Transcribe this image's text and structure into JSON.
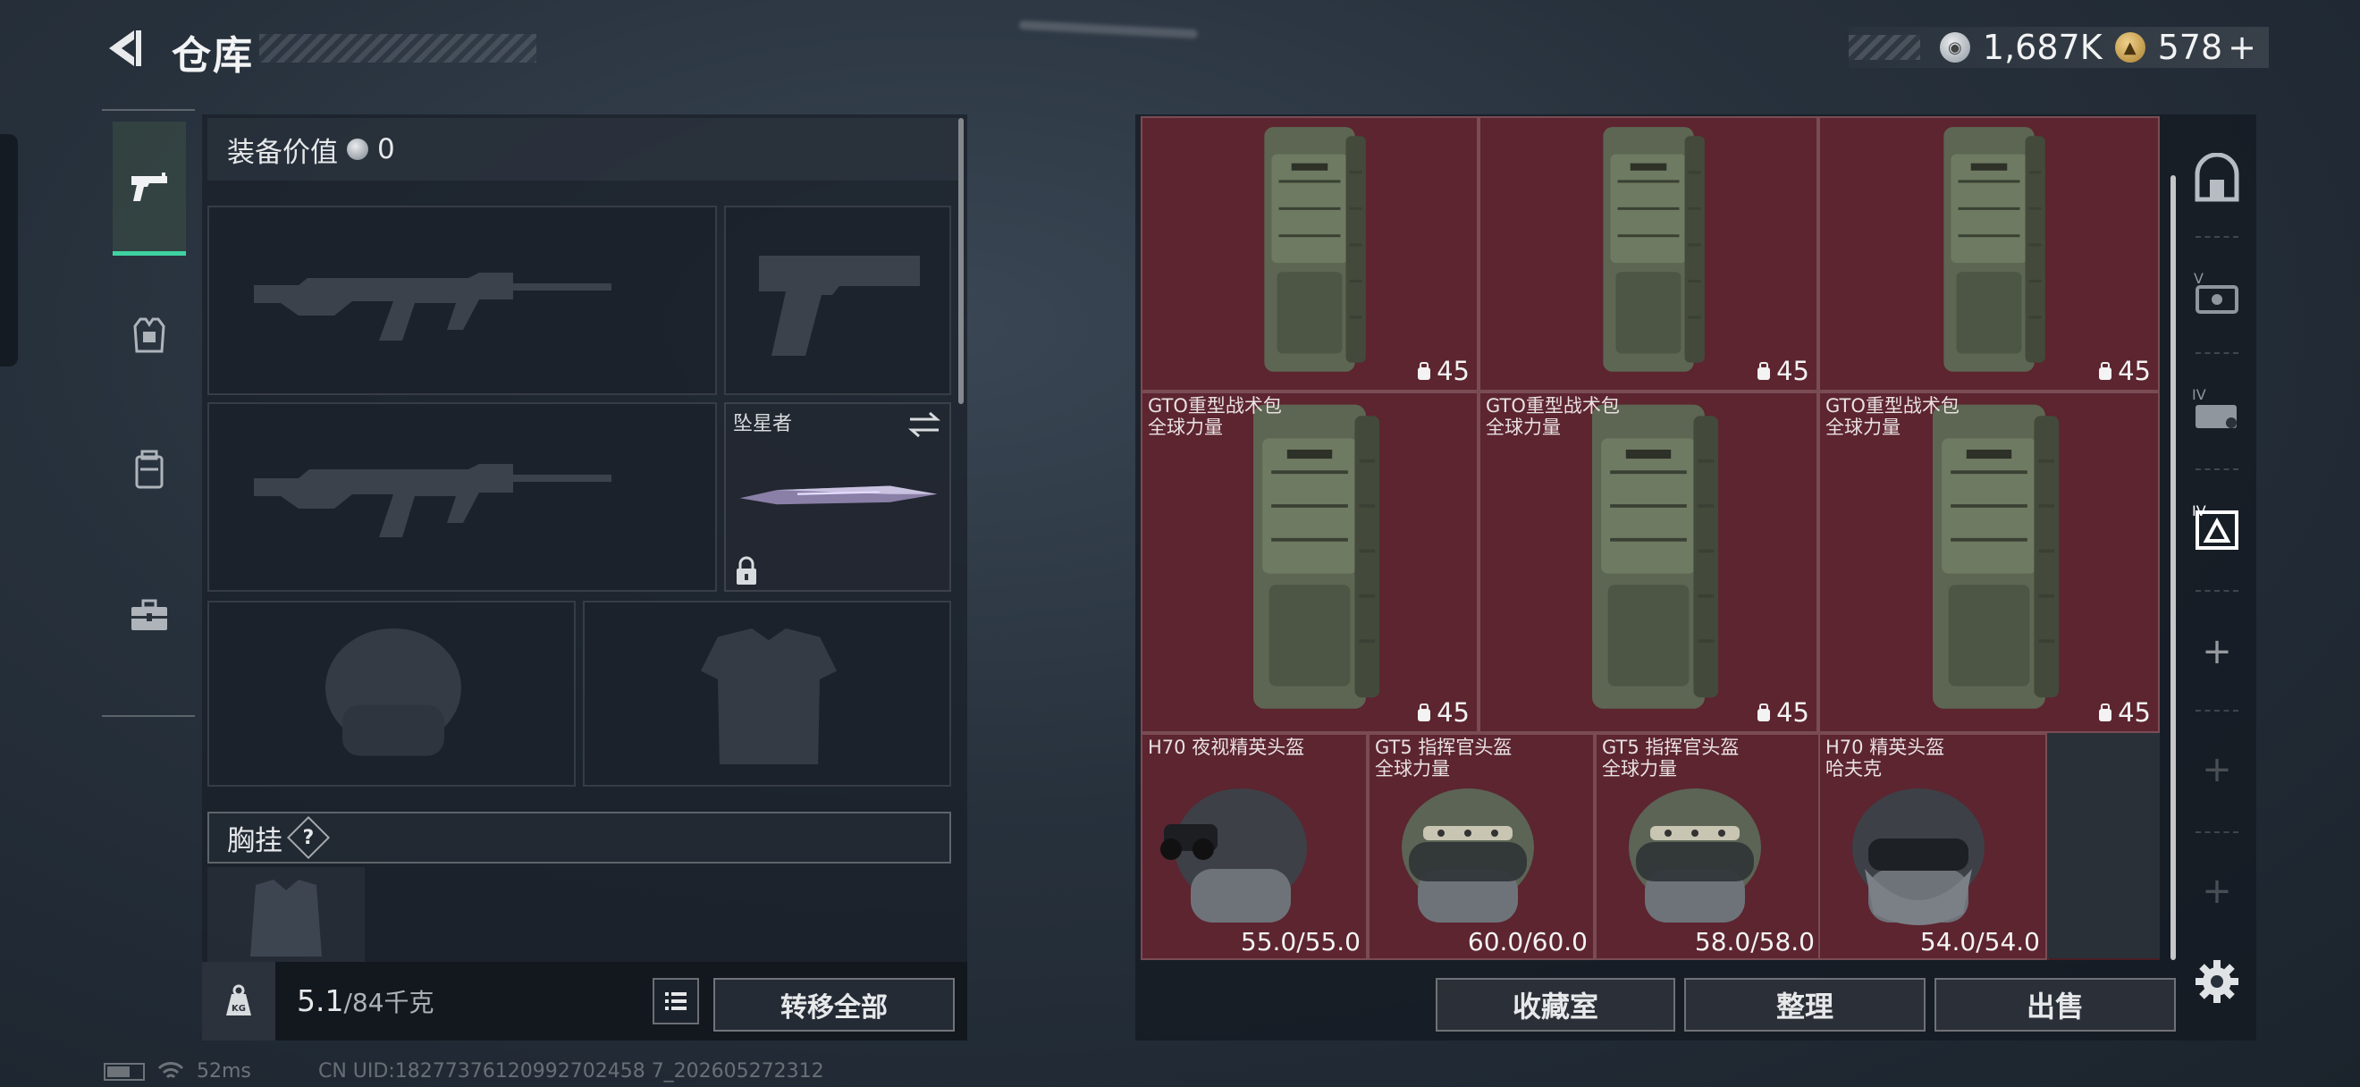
{
  "header": {
    "title": "仓库",
    "currency_silver": "1,687K",
    "currency_gold": "578",
    "add_symbol": "+"
  },
  "left_rail": {
    "items": [
      {
        "icon": "pistol-icon",
        "active": true
      },
      {
        "icon": "armor-vest-icon",
        "active": false
      },
      {
        "icon": "backpack-icon",
        "active": false
      },
      {
        "icon": "toolbox-icon",
        "active": false
      }
    ]
  },
  "loadout": {
    "value_label": "装备价值",
    "value_amount": "0",
    "melee_name": "坠星者",
    "chest_rig_label": "胸挂",
    "help_symbol": "?",
    "weight_current": "5.1",
    "weight_max": "/84千克",
    "weight_icon_text": "KG",
    "transfer_all_label": "转移全部"
  },
  "stash": {
    "items": [
      {
        "type": "backpack",
        "name1": "",
        "name2": "",
        "count": "45"
      },
      {
        "type": "backpack",
        "name1": "",
        "name2": "",
        "count": "45"
      },
      {
        "type": "backpack",
        "name1": "",
        "name2": "",
        "count": "45"
      },
      {
        "type": "backpack",
        "name1": "GTO重型战术包",
        "name2": "全球力量",
        "count": "45"
      },
      {
        "type": "backpack",
        "name1": "GTO重型战术包",
        "name2": "全球力量",
        "count": "45"
      },
      {
        "type": "backpack",
        "name1": "GTO重型战术包",
        "name2": "全球力量",
        "count": "45"
      },
      {
        "type": "helmet-nv",
        "name1": "H70 夜视精英头盔",
        "name2": "",
        "durability": "55.0/55.0"
      },
      {
        "type": "helmet-cmd",
        "name1": "GT5 指挥官头盔",
        "name2": "全球力量",
        "durability": "60.0/60.0"
      },
      {
        "type": "helmet-cmd",
        "name1": "GT5 指挥官头盔",
        "name2": "全球力量",
        "durability": "58.0/58.0"
      },
      {
        "type": "helmet-elite",
        "name1": "H70 精英头盔",
        "name2": "哈夫克",
        "durability": "54.0/54.0"
      }
    ],
    "buttons": {
      "collection": "收藏室",
      "sort": "整理",
      "sell": "出售"
    }
  },
  "right_rail": {
    "items": [
      "safe-box-icon",
      "case-v-icon",
      "case-iv-icon",
      "case-iv-active-icon"
    ],
    "plus": "+"
  },
  "status": {
    "ping": "52ms",
    "uid": "CN UID:18277376120992702458 7_202605272312"
  },
  "colors": {
    "accent": "#3fd3a2",
    "stash_cell": "#5c2530",
    "stash_bg": "#4a1e25"
  }
}
